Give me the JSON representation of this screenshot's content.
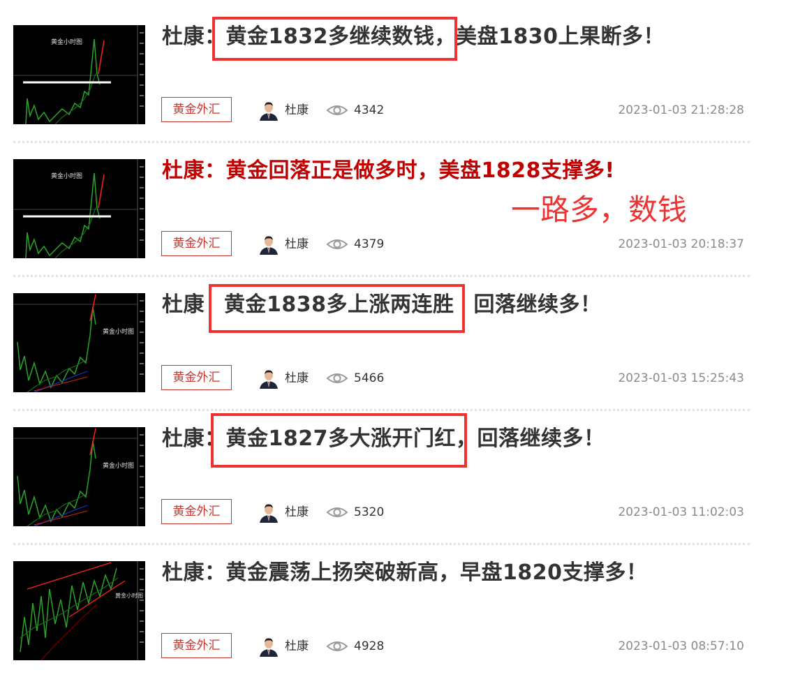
{
  "articles": [
    {
      "title_prefix": "杜康：",
      "title_highlight": "黄金1832多继续数钱，",
      "title_suffix": "美盘1830上果断多！",
      "tag": "黄金外汇",
      "author": "杜康",
      "views": "4342",
      "date": "2023-01-03 21:28:28",
      "thumb_label": "黄金小时图"
    },
    {
      "title": "杜康：黄金回落正是做多时，美盘1828支撑多!",
      "tag": "黄金外汇",
      "author": "杜康",
      "views": "4379",
      "date": "2023-01-03 20:18:37",
      "thumb_label": "黄金小时图"
    },
    {
      "title_prefix": "杜康",
      "title_highlight": "黄金1838多上涨两连胜",
      "title_suffix": "回落继续多！",
      "tag": "黄金外汇",
      "author": "杜康",
      "views": "5466",
      "date": "2023-01-03 15:25:43",
      "thumb_label": "黄金小时图"
    },
    {
      "title_prefix": "杜康：",
      "title_highlight": "黄金1827多大涨开门红，",
      "title_suffix": "回落继续多！",
      "tag": "黄金外汇",
      "author": "杜康",
      "views": "5320",
      "date": "2023-01-03 11:02:03",
      "thumb_label": "黄金小时图"
    },
    {
      "title": "杜康：黄金震荡上扬突破新高，早盘1820支撑多！",
      "tag": "黄金外汇",
      "author": "杜康",
      "views": "4928",
      "date": "2023-01-03 08:57:10",
      "thumb_label": "黄金小时图"
    }
  ],
  "annotation": "一路多，数钱",
  "colors": {
    "highlight_box": "#ee3333",
    "tag": "#c8352e",
    "title": "#333333",
    "title_red": "#c00000",
    "date": "#8a8a8a"
  },
  "icons": [
    "avatar",
    "eye-icon"
  ]
}
